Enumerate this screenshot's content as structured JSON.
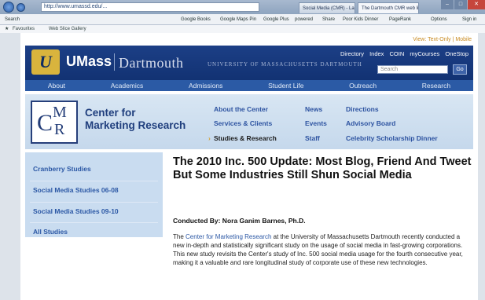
{
  "browser": {
    "address": "http://www.umassd.edu/...",
    "tabs": [
      "Social Media (CMR) - Largest...",
      "The Dartmouth CMR web link..."
    ],
    "menu": [
      "Search",
      "Google Books",
      "Google Maps Pin",
      "Google Plus",
      "powered",
      "Share",
      "Poor Kids Dinner",
      "PageRank",
      "Options",
      "Sign in"
    ],
    "favorites": [
      "Favourites",
      "Web Slice Gallery"
    ]
  },
  "top_links": "View: Text-Only | Mobile",
  "umass": {
    "logo": "U",
    "name": "UMass",
    "campus": "Dartmouth",
    "tagline": "UNIVERSITY OF MASSACHUSETTS DARTMOUTH",
    "util_links": [
      "Directory",
      "Index",
      "COIN",
      "myCourses",
      "OneStop"
    ],
    "search_placeholder": "Search",
    "go_label": "Go",
    "nav": [
      "About",
      "Academics",
      "Admissions",
      "Student Life",
      "Outreach",
      "Research"
    ]
  },
  "cmr": {
    "logo": {
      "c": "C",
      "m": "M",
      "r": "R"
    },
    "title_line1": "Center for",
    "title_line2": "Marketing Research",
    "nav": {
      "about": "About the Center",
      "services": "Services & Clients",
      "studies": "Studies & Research",
      "news": "News",
      "events": "Events",
      "staff": "Staff",
      "directions": "Directions",
      "advisory": "Advisory Board",
      "celebrity": "Celebrity Scholarship Dinner"
    }
  },
  "sidebar": [
    "Cranberry Studies",
    "Social Media Studies 06-08",
    "Social Media Studies 09-10",
    "All Studies"
  ],
  "article": {
    "headline": "The 2010 Inc. 500 Update: Most Blog, Friend And Tweet But Some Industries Still Shun Social Media",
    "byline": "Conducted By: Nora Ganim Barnes, Ph.D.",
    "body_prefix": "The ",
    "body_link": "Center for Marketing Research",
    "body_rest": " at the University of Massachusetts Dartmouth recently conducted a new in-depth and statistically significant study on the usage of social media in fast-growing corporations. This new study revisits the Center's study of Inc. 500 social media usage for the fourth consecutive year, making it a valuable and rare longitudinal study of corporate use of these new technologies."
  }
}
